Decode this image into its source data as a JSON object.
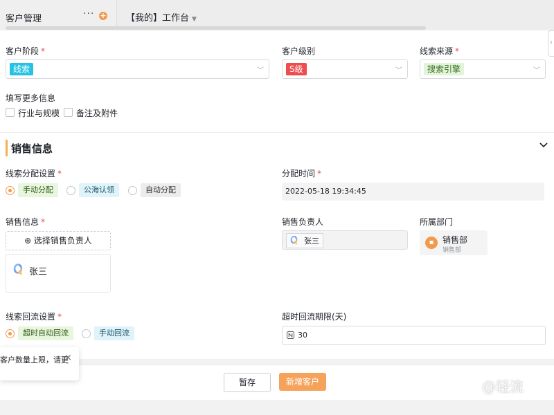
{
  "topbar": {
    "title": "客户管理",
    "dots": "···",
    "plus": "+",
    "tab": "【我的】工作台",
    "tab_caret": "▼"
  },
  "basic": {
    "stage": {
      "label": "客户阶段",
      "required": "*",
      "value": "线索",
      "tag_bg": "#27c2e3",
      "tag_color": "#ffffff"
    },
    "level": {
      "label": "客户级别",
      "value": "S级",
      "tag_bg": "#ef4d4d",
      "tag_color": "#ffffff"
    },
    "source": {
      "label": "线索来源",
      "required": "*",
      "value": "搜索引擎",
      "tag_bg": "#e2f5d8",
      "tag_color": "#3a6b24"
    },
    "more_label": "填写更多信息",
    "more_options": [
      "行业与规模",
      "备注及附件"
    ]
  },
  "sales_section": {
    "title": "销售信息",
    "collapse_icon": "chevron-down-icon",
    "assign": {
      "label": "线索分配设置",
      "required": "*",
      "options": [
        {
          "label": "手动分配",
          "selected": true,
          "bg": "#e8f6dd",
          "color": "#2f5a1d"
        },
        {
          "label": "公海认领",
          "selected": false,
          "bg": "#dff3fa",
          "color": "#1f5566"
        },
        {
          "label": "自动分配",
          "selected": false,
          "bg": "#ececec",
          "color": "#333333"
        }
      ]
    },
    "assign_time": {
      "label": "分配时间",
      "required": "*",
      "value": "2022-05-18 19:34:45"
    },
    "sales_info": {
      "label": "销售信息",
      "required": "*",
      "add_button": "⊕ 选择销售负责人",
      "user": "张三"
    },
    "owner": {
      "label": "销售负责人",
      "value": "张三"
    },
    "dept": {
      "label": "所属部门",
      "name": "销售部",
      "sub": "销售部"
    },
    "reflow": {
      "label": "线索回流设置",
      "required": "*",
      "options": [
        {
          "label": "超时自动回流",
          "selected": true,
          "bg": "#e8f6dd",
          "color": "#2f5a1d"
        },
        {
          "label": "手动回流",
          "selected": false,
          "bg": "#dff3fa",
          "color": "#1f5566"
        }
      ]
    },
    "timeout": {
      "label": "超时回流期限(天)",
      "value": "30"
    }
  },
  "toast": {
    "text": "客户数量上限，请更",
    "close": "×"
  },
  "footer": {
    "save_draft": "暂存",
    "submit": "新增客户"
  },
  "watermark": "@轻流",
  "colors": {
    "accent": "#f29a4a",
    "required": "#e34d59"
  }
}
